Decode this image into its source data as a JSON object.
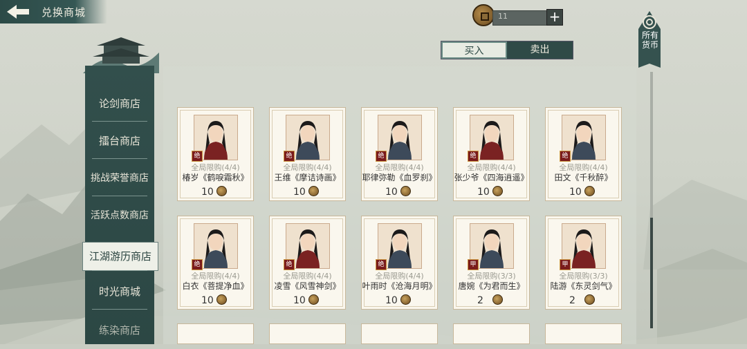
{
  "header": {
    "title": "兑换商城"
  },
  "currency": {
    "amount": "11",
    "plus_label": "+"
  },
  "tabs": {
    "buy": "买入",
    "sell": "卖出"
  },
  "all_currency": {
    "label": "所有货币"
  },
  "sidebar": {
    "items": [
      {
        "label": "论剑商店"
      },
      {
        "label": "擂台商店"
      },
      {
        "label": "挑战荣誉商店"
      },
      {
        "label": "活跃点数商店"
      },
      {
        "label": "江湖游历商店",
        "active": true
      },
      {
        "label": "时光商城"
      },
      {
        "label": "练染商店"
      }
    ]
  },
  "items": [
    {
      "name": "椿岁《鹤唳霜秋》",
      "limit": "全局限购(4/4)",
      "price": "10",
      "badge": "绝"
    },
    {
      "name": "王维《摩诘诗画》",
      "limit": "全局限购(4/4)",
      "price": "10",
      "badge": "绝"
    },
    {
      "name": "耶律弥勒《血罗刹》",
      "limit": "全局限购(4/4)",
      "price": "10",
      "badge": "绝"
    },
    {
      "name": "张少爷《四海逍遥》",
      "limit": "全局限购(4/4)",
      "price": "10",
      "badge": "绝"
    },
    {
      "name": "田文《千秋醉》",
      "limit": "全局限购(4/4)",
      "price": "10",
      "badge": "绝"
    },
    {
      "name": "白衣《菩提净血》",
      "limit": "全局限购(4/4)",
      "price": "10",
      "badge": "绝"
    },
    {
      "name": "凌雪《风雪神剑》",
      "limit": "全局限购(4/4)",
      "price": "10",
      "badge": "绝"
    },
    {
      "name": "叶雨时《沧海月明》",
      "limit": "全局限购(4/4)",
      "price": "10",
      "badge": "绝"
    },
    {
      "name": "唐婉《为君而生》",
      "limit": "全局限购(3/3)",
      "price": "2",
      "badge": "甲"
    },
    {
      "name": "陆游《东灵剑气》",
      "limit": "全局限购(3/3)",
      "price": "2",
      "badge": "甲"
    }
  ],
  "colors": {
    "accent": "#2f4a47",
    "badge_red": "#7a1b1b",
    "card_bg": "#faf7ee"
  }
}
